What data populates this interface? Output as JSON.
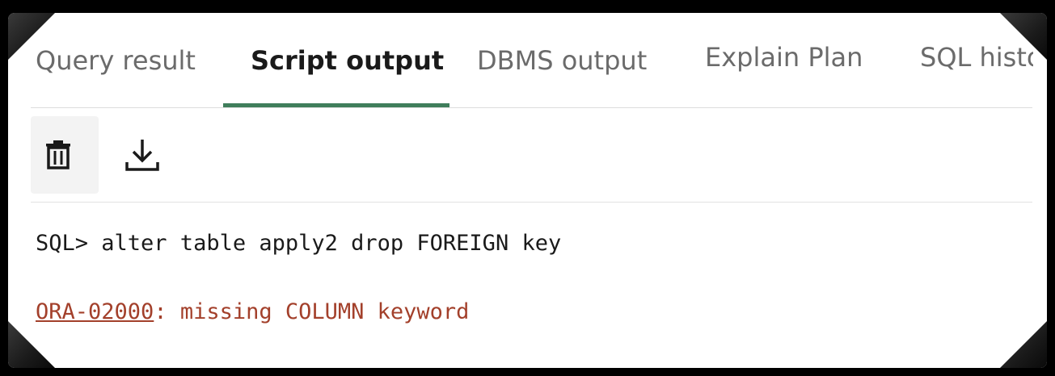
{
  "tabs": [
    {
      "label": "Query result",
      "active": false
    },
    {
      "label": "Script output",
      "active": true
    },
    {
      "label": "DBMS output",
      "active": false
    },
    {
      "label": "Explain Plan",
      "active": false
    },
    {
      "label": "SQL history",
      "active": false
    }
  ],
  "toolbar": {
    "clear_icon": "trash-icon",
    "download_icon": "download-icon"
  },
  "output": {
    "command": "SQL> alter table apply2 drop FOREIGN key",
    "error_code": "ORA-02000",
    "error_message": ": missing COLUMN keyword"
  },
  "colors": {
    "active_tab_underline": "#3f7e5b",
    "error_text": "#a3402b"
  }
}
